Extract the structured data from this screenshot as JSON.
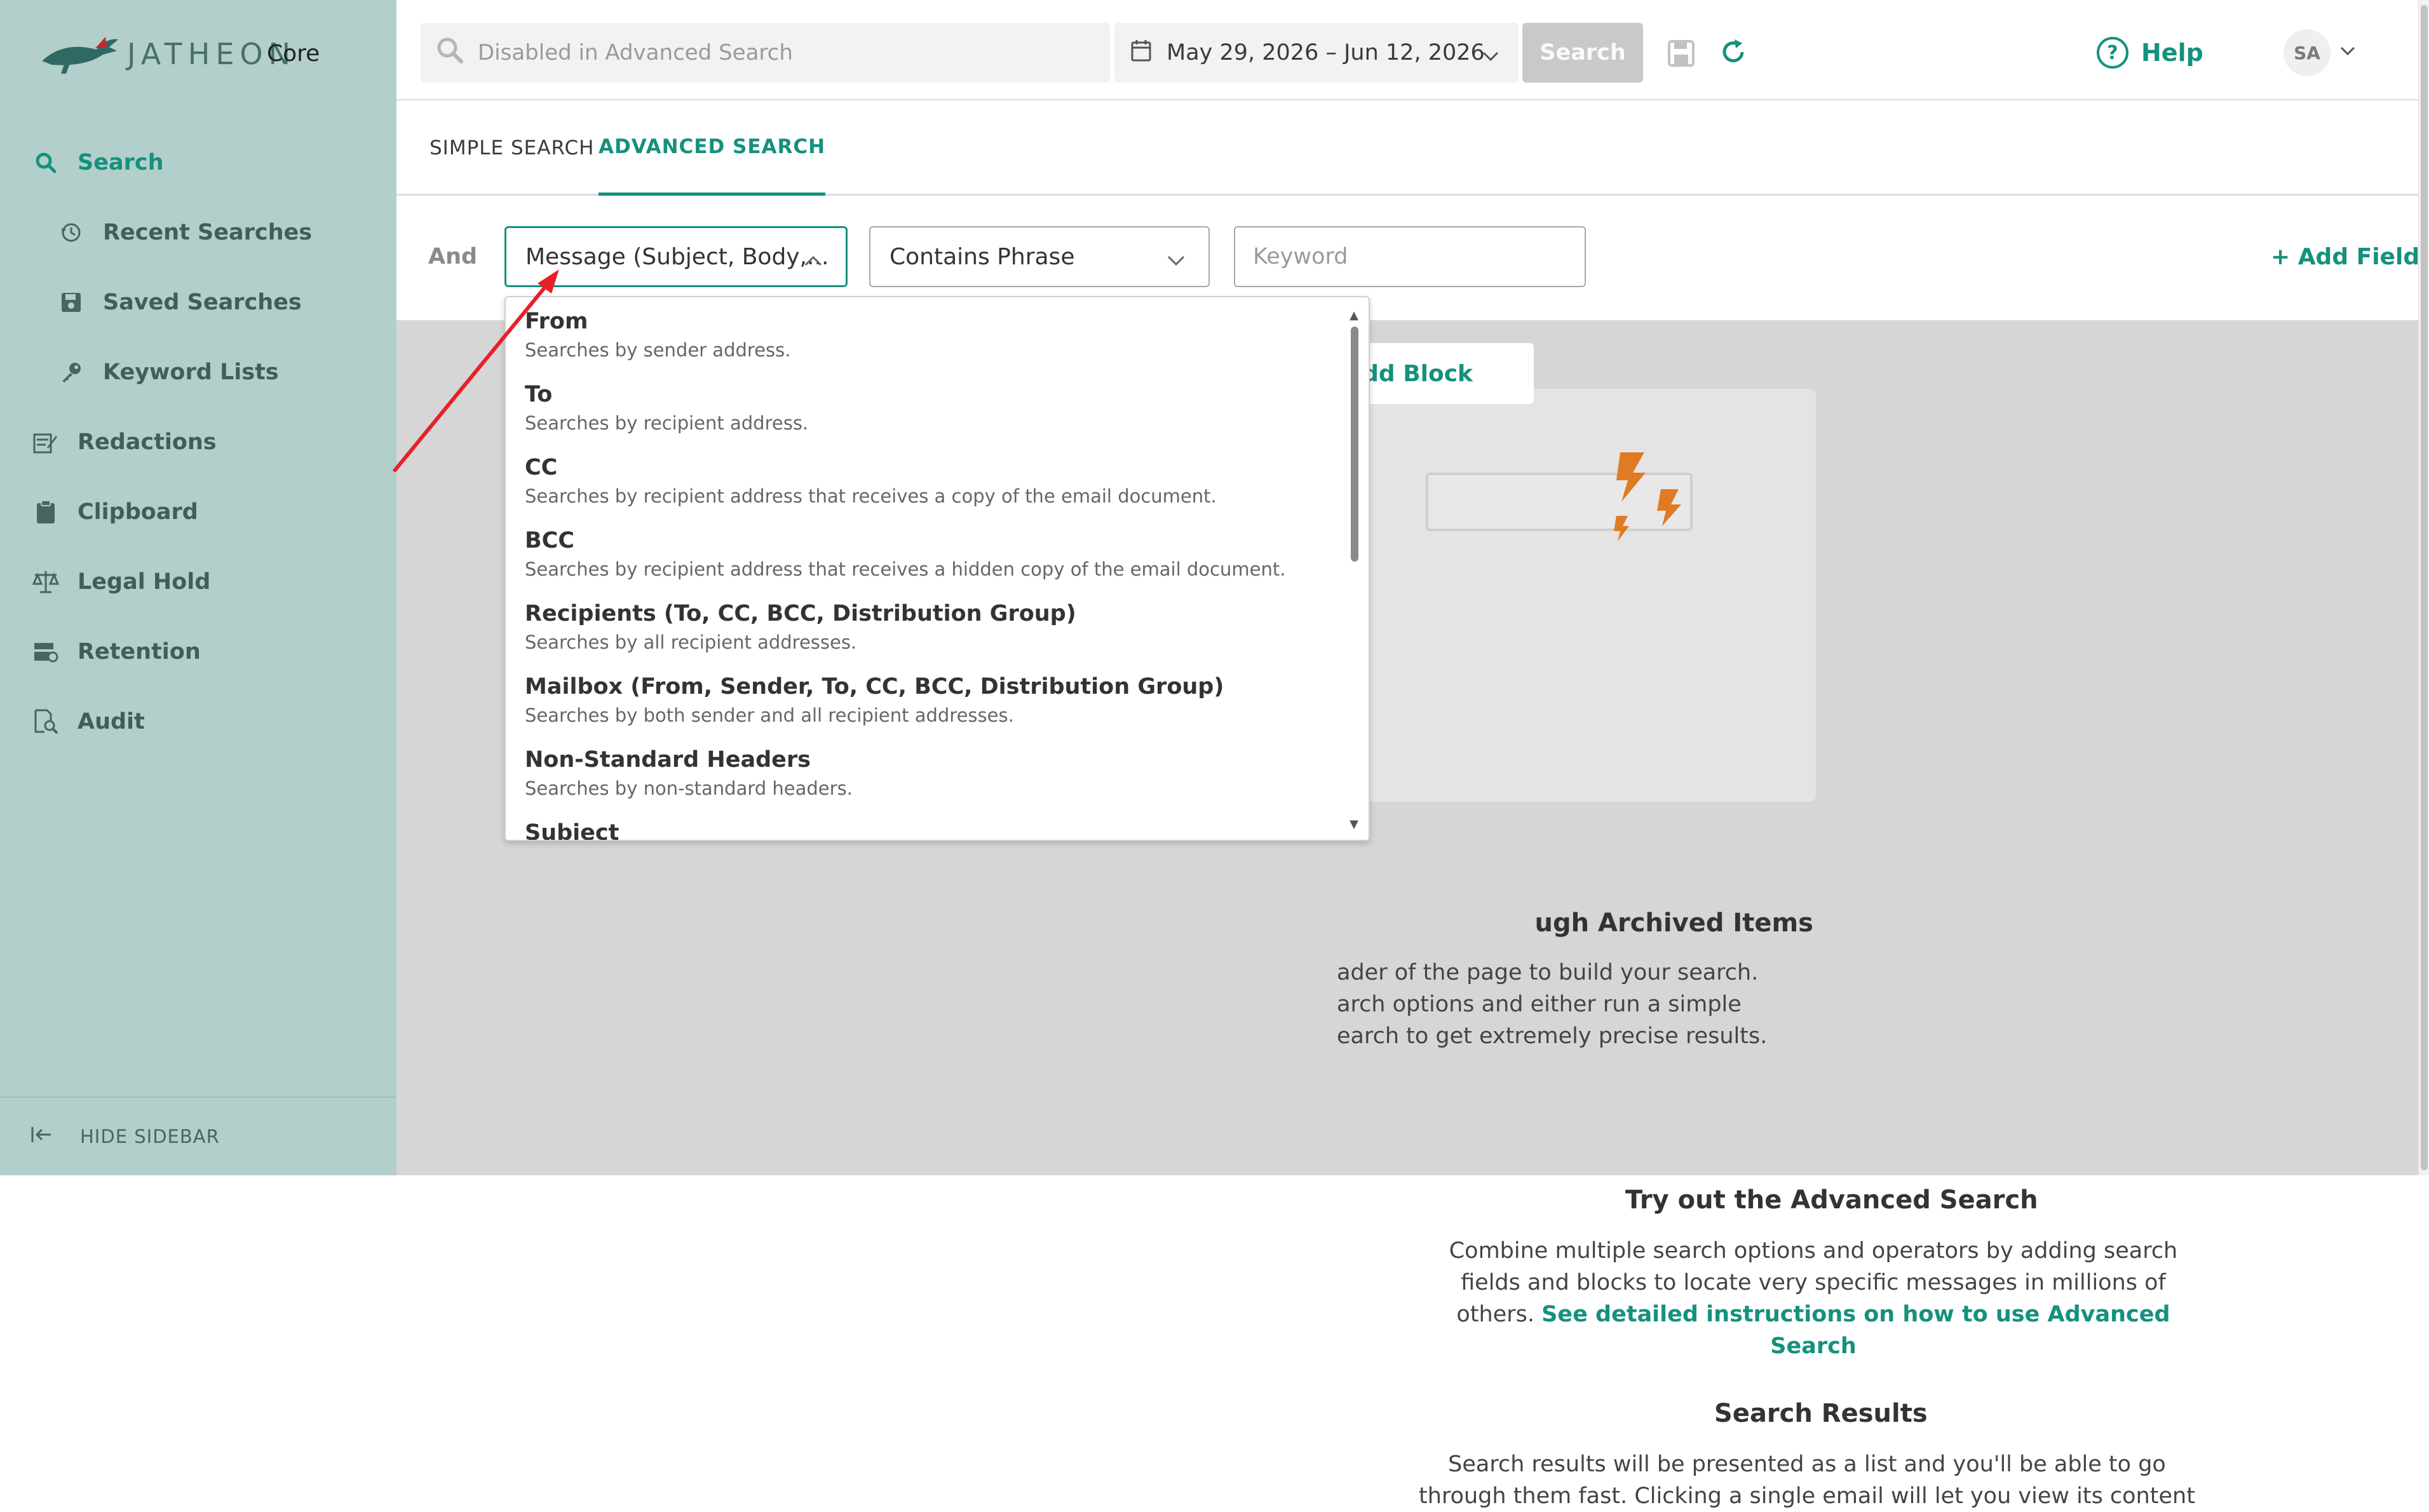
{
  "brand": {
    "name": "JATHEON",
    "product": "Core"
  },
  "sidebar": {
    "items": [
      {
        "label": "Search",
        "icon": "search-icon"
      },
      {
        "label": "Recent Searches",
        "icon": "history-icon"
      },
      {
        "label": "Saved Searches",
        "icon": "save-icon"
      },
      {
        "label": "Keyword Lists",
        "icon": "key-icon"
      },
      {
        "label": "Redactions",
        "icon": "redaction-icon"
      },
      {
        "label": "Clipboard",
        "icon": "clipboard-icon"
      },
      {
        "label": "Legal Hold",
        "icon": "scale-icon"
      },
      {
        "label": "Retention",
        "icon": "retention-icon"
      },
      {
        "label": "Audit",
        "icon": "audit-icon"
      }
    ],
    "hide_label": "HIDE SIDEBAR"
  },
  "topbar": {
    "search_placeholder": "Disabled in Advanced Search",
    "date_range": "May 29, 2026 – Jun 12, 2026",
    "search_button": "Search",
    "help_label": "Help",
    "avatar_initials": "SA"
  },
  "tabs": [
    {
      "label": "SIMPLE SEARCH"
    },
    {
      "label": "ADVANCED SEARCH"
    }
  ],
  "field_row": {
    "operator": "And",
    "field_value": "Message (Subject, Body,...",
    "condition_value": "Contains Phrase",
    "keyword_placeholder": "Keyword",
    "add_field": "+ Add Field"
  },
  "dropdown": {
    "options": [
      {
        "title": "From",
        "desc": "Searches by sender address."
      },
      {
        "title": "To",
        "desc": "Searches by recipient address."
      },
      {
        "title": "CC",
        "desc": "Searches by recipient address that receives a copy of the email document."
      },
      {
        "title": "BCC",
        "desc": "Searches by recipient address that receives a hidden copy of the email document."
      },
      {
        "title": "Recipients (To, CC, BCC, Distribution Group)",
        "desc": "Searches by all recipient addresses."
      },
      {
        "title": "Mailbox (From, Sender, To, CC, BCC, Distribution Group)",
        "desc": "Searches by both sender and all recipient addresses."
      },
      {
        "title": "Non-Standard Headers",
        "desc": "Searches by non-standard headers."
      },
      {
        "title": "Subject",
        "desc": ""
      }
    ]
  },
  "main": {
    "add_block": "dd Block",
    "welcome_title": "ugh Archived Items",
    "welcome_lines": [
      "ader of the page to build your search.",
      "arch options and either run a simple",
      "earch to get extremely precise results."
    ],
    "advanced_title": "Try out the Advanced Search",
    "advanced_text": "Combine multiple search options and operators by adding search fields and blocks to locate very specific messages in millions of others.",
    "advanced_link": "See detailed instructions on how to use Advanced Search",
    "results_title": "Search Results",
    "results_text": "Search results will be presented as a list and you'll be able to go through them fast. Clicking a single email will let you view its content"
  },
  "colors": {
    "accent": "#15917d",
    "sidebar": "#b3cfcb",
    "annotation": "#e8202a",
    "bolt": "#e07b24"
  }
}
